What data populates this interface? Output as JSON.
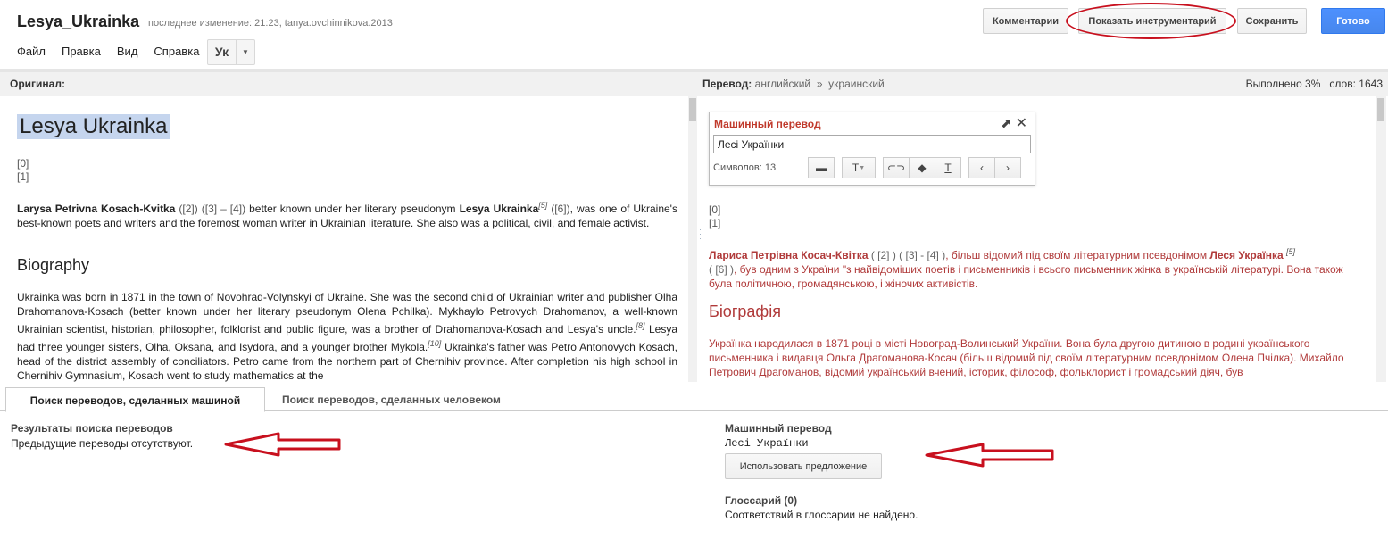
{
  "header": {
    "doc_title": "Lesya_Ukrainka",
    "doc_meta": "последнее изменение: 21:23, tanya.ovchinnikova.2013",
    "menu": [
      "Файл",
      "Правка",
      "Вид",
      "Справка"
    ],
    "lang_value": "Ук",
    "buttons": {
      "comments": "Комментарии",
      "show_tools": "Показать инструментарий",
      "save": "Сохранить",
      "done": "Готово"
    },
    "accent_color": "#4d90fe",
    "annotation_color": "#c8101e"
  },
  "columns": {
    "original_label": "Оригинал:",
    "translation_label": "Перевод:",
    "source_lang": "английский",
    "arrow": "»",
    "target_lang": "украинский",
    "progress": "Выполнено 3%",
    "words_label": "слов:",
    "words_count": "1643"
  },
  "original": {
    "title": "Lesya Ukrainka",
    "refs": [
      "[0]",
      "[1]"
    ],
    "p1": {
      "name": "Larysa Petrivna Kosach-Kvitka",
      "refs_a": "([2]) ([3] – [4])",
      "mid": "better known under her literary pseudonym",
      "pseudonym": "Lesya Ukrainka",
      "sup5": "[5]",
      "ref6": "([6])",
      "rest": ", was one of Ukraine's best-known poets and writers and the foremost woman writer in Ukrainian literature. She also was a political, civil, and female activist."
    },
    "h2": "Biography",
    "p2_a": "Ukrainka was born in 1871 in the town of Novohrad-Volynskyi of Ukraine. She was the second child of Ukrainian writer and publisher Olha Drahomanova-Kosach (better known under her literary pseudonym Olena Pchilka). Mykhaylo Petrovych Drahomanov, a well-known Ukrainian scientist, historian, philosopher, folklorist and public figure, was a brother of Drahomanova-Kosach and Lesya's uncle.",
    "sup8": "[8]",
    "p2_b": " Lesya had three younger sisters, Olha, Oksana, and Isydora, and a younger brother Mykola.",
    "sup10": "[10]",
    "p2_c": " Ukrainka's father was Petro Antonovych Kosach, head of the district assembly of conciliators. Petro came from the northern part of Chernihiv province. After completion his high school in Chernihiv Gymnasium, Kosach went to study mathematics at the"
  },
  "mt_box": {
    "title": "Машинный перевод",
    "input_value": "Лесі Українки",
    "count_label": "Символов: 13",
    "tools": [
      "comment-icon",
      "text-format-icon",
      "link-icon",
      "eraser-icon",
      "clear-format-icon",
      "prev-icon",
      "next-icon"
    ]
  },
  "translation": {
    "refs": [
      "[0]",
      "[1]"
    ],
    "p1": {
      "name": "Лариса Петрівна Косач-Квітка",
      "refs_a": "( [2] ) ( [3] - [4] )",
      "mid": ", більш відомий під своїм літературним псевдонімом",
      "pseudonym": "Леся Українка",
      "sup5": "[5]",
      "ref6": "( [6] )",
      "rest": ", був одним з України \"з найвідоміших поетів і письменників і всього письменник жінка в українській літературі. Вона також була політичною, громадянською, і жіночих активістів."
    },
    "h2": "Біографія",
    "p2": "Українка народилася в 1871 році в місті Новоград-Волинський України. Вона була другою дитиною в родині українського письменника і видавця Ольга Драгоманова-Косач (більш відомий під своїм літературним псевдонімом Олена Пчілка). Михайло Петрович Драгоманов, відомий український вчений, історик, філософ, фольклорист і громадський діяч, був"
  },
  "tabs": {
    "machine": "Поиск переводов, сделанных машиной",
    "human": "Поиск переводов, сделанных человеком"
  },
  "bottom": {
    "results_title": "Результаты поиска переводов",
    "results_text": "Предыдущие переводы отсутствуют.",
    "mt_title": "Машинный перевод",
    "mt_text": "Лесі Українки",
    "use_button": "Использовать предложение",
    "glossary_title": "Глоссарий (0)",
    "glossary_text": "Соответствий в глоссарии не найдено."
  }
}
